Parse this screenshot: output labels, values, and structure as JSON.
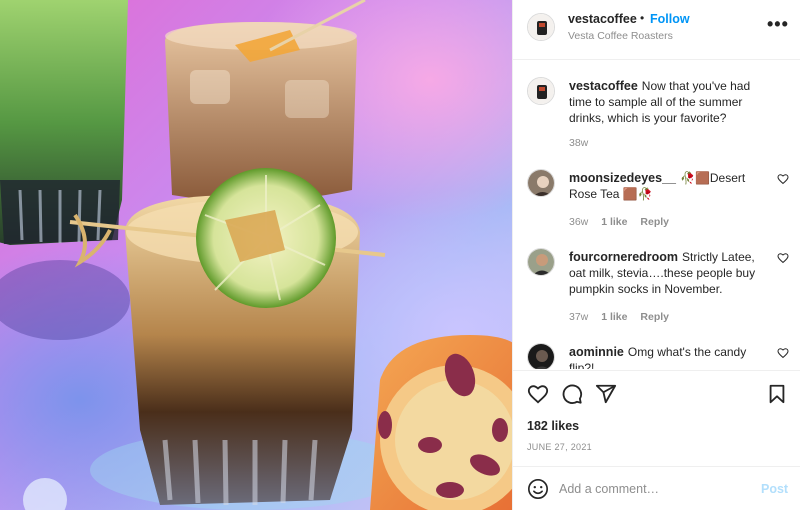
{
  "post": {
    "username": "vestacoffee",
    "follow_label": "Follow",
    "location": "Vesta Coffee Roasters",
    "separator": "•",
    "more_label": "•••"
  },
  "comments": [
    {
      "username": "vestacoffee",
      "text": "Now that you've had time to sample all of the summer drinks, which is your favorite?",
      "time": "38w"
    },
    {
      "username": "moonsizedeyes__",
      "text": "🥀🟫Desert Rose Tea 🟫🥀",
      "time": "36w",
      "likes": "1 like",
      "reply": "Reply"
    },
    {
      "username": "fourcorneredroom",
      "text": "Strictly Latee, oat milk, stevia….these people buy pumpkin socks in November.",
      "time": "37w",
      "likes": "1 like",
      "reply": "Reply"
    },
    {
      "username": "aominnie",
      "text": "Omg what's the candy flip?!"
    }
  ],
  "likes_label": "182 likes",
  "date_label": "JUNE 27, 2021",
  "add_comment": {
    "placeholder": "Add a comment…",
    "post_label": "Post"
  },
  "colors": {
    "accent": "#0095f6",
    "post_disabled": "#b2dffc",
    "muted": "#8e8e8e"
  },
  "icons": [
    "heart-icon",
    "comment-icon",
    "share-icon",
    "bookmark-icon",
    "emoji-icon",
    "more-icon"
  ]
}
